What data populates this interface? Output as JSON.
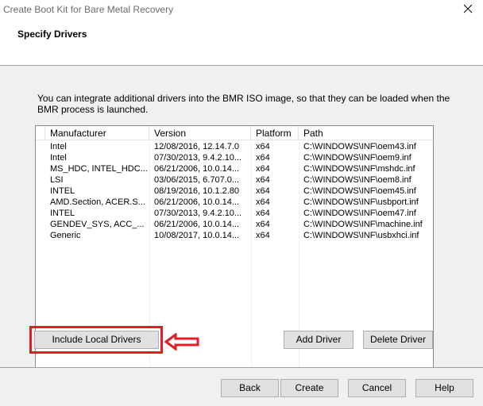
{
  "window": {
    "title": "Create Boot Kit for Bare Metal Recovery",
    "close_icon": "close-icon"
  },
  "header": {
    "title": "Specify Drivers"
  },
  "description": "You can integrate additional drivers into the BMR ISO image, so that they can be loaded when the BMR process is launched.",
  "drivers_table": {
    "columns": [
      "Manufacturer",
      "Version",
      "Platform",
      "Path"
    ],
    "rows": [
      [
        "Intel",
        "12/08/2016, 12.14.7.0",
        "x64",
        "C:\\WINDOWS\\INF\\oem43.inf"
      ],
      [
        "Intel",
        "07/30/2013, 9.4.2.10...",
        "x64",
        "C:\\WINDOWS\\INF\\oem9.inf"
      ],
      [
        "MS_HDC, INTEL_HDC...",
        "06/21/2006, 10.0.14...",
        "x64",
        "C:\\WINDOWS\\INF\\mshdc.inf"
      ],
      [
        "LSI",
        "03/06/2015, 6.707.0...",
        "x64",
        "C:\\WINDOWS\\INF\\oem8.inf"
      ],
      [
        "INTEL",
        "08/19/2016, 10.1.2.80",
        "x64",
        "C:\\WINDOWS\\INF\\oem45.inf"
      ],
      [
        "AMD.Section, ACER.S...",
        "06/21/2006, 10.0.14...",
        "x64",
        "C:\\WINDOWS\\INF\\usbport.inf"
      ],
      [
        "INTEL",
        "07/30/2013, 9.4.2.10...",
        "x64",
        "C:\\WINDOWS\\INF\\oem47.inf"
      ],
      [
        "GENDEV_SYS, ACC_...",
        "06/21/2006, 10.0.14...",
        "x64",
        "C:\\WINDOWS\\INF\\machine.inf"
      ],
      [
        "Generic",
        "10/08/2017, 10.0.14...",
        "x64",
        "C:\\WINDOWS\\INF\\usbxhci.inf"
      ]
    ],
    "scroll_left_icon": "chevron-left-icon",
    "scroll_right_icon": "chevron-right-icon"
  },
  "buttons": {
    "include_local": "Include Local Drivers",
    "add_driver": "Add Driver",
    "delete_driver": "Delete Driver",
    "back": "Back",
    "create": "Create",
    "cancel": "Cancel",
    "help": "Help"
  },
  "annotation": {
    "highlight_color": "#e21b24",
    "arrow_icon": "left-arrow-icon"
  }
}
